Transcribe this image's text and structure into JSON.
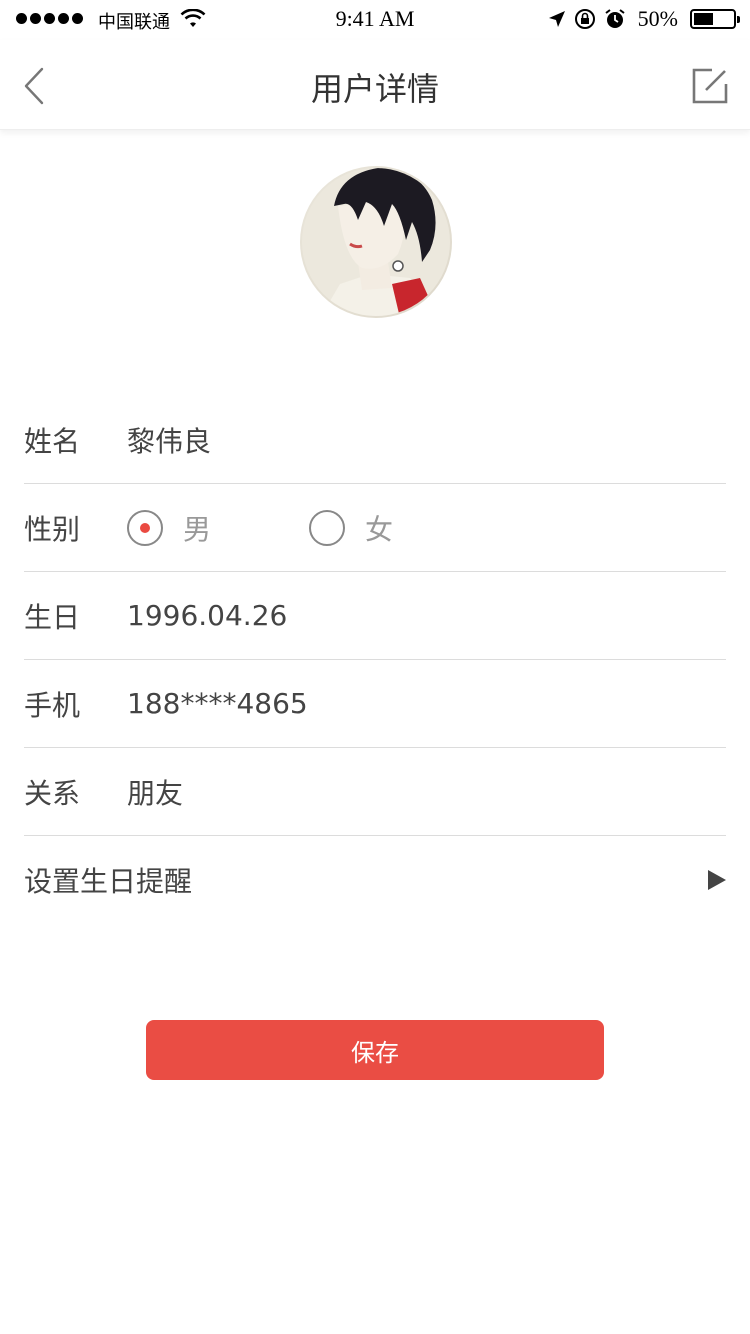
{
  "status_bar": {
    "carrier": "中国联通",
    "time": "9:41 AM",
    "battery": "50%",
    "battery_level": 0.5
  },
  "nav": {
    "title": "用户详情",
    "back_icon": "chevron-left-icon",
    "edit_icon": "edit-icon"
  },
  "form": {
    "name": {
      "label": "姓名",
      "value": "黎伟良"
    },
    "gender": {
      "label": "性别",
      "options": [
        "男",
        "女"
      ],
      "selected": "男"
    },
    "birthday": {
      "label": "生日",
      "value": "1996.04.26"
    },
    "phone": {
      "label": "手机",
      "value": "188****4865"
    },
    "relation": {
      "label": "关系",
      "value": "朋友"
    },
    "reminder": {
      "label": "设置生日提醒"
    }
  },
  "save_label": "保存",
  "colors": {
    "accent": "#ea4d44"
  }
}
